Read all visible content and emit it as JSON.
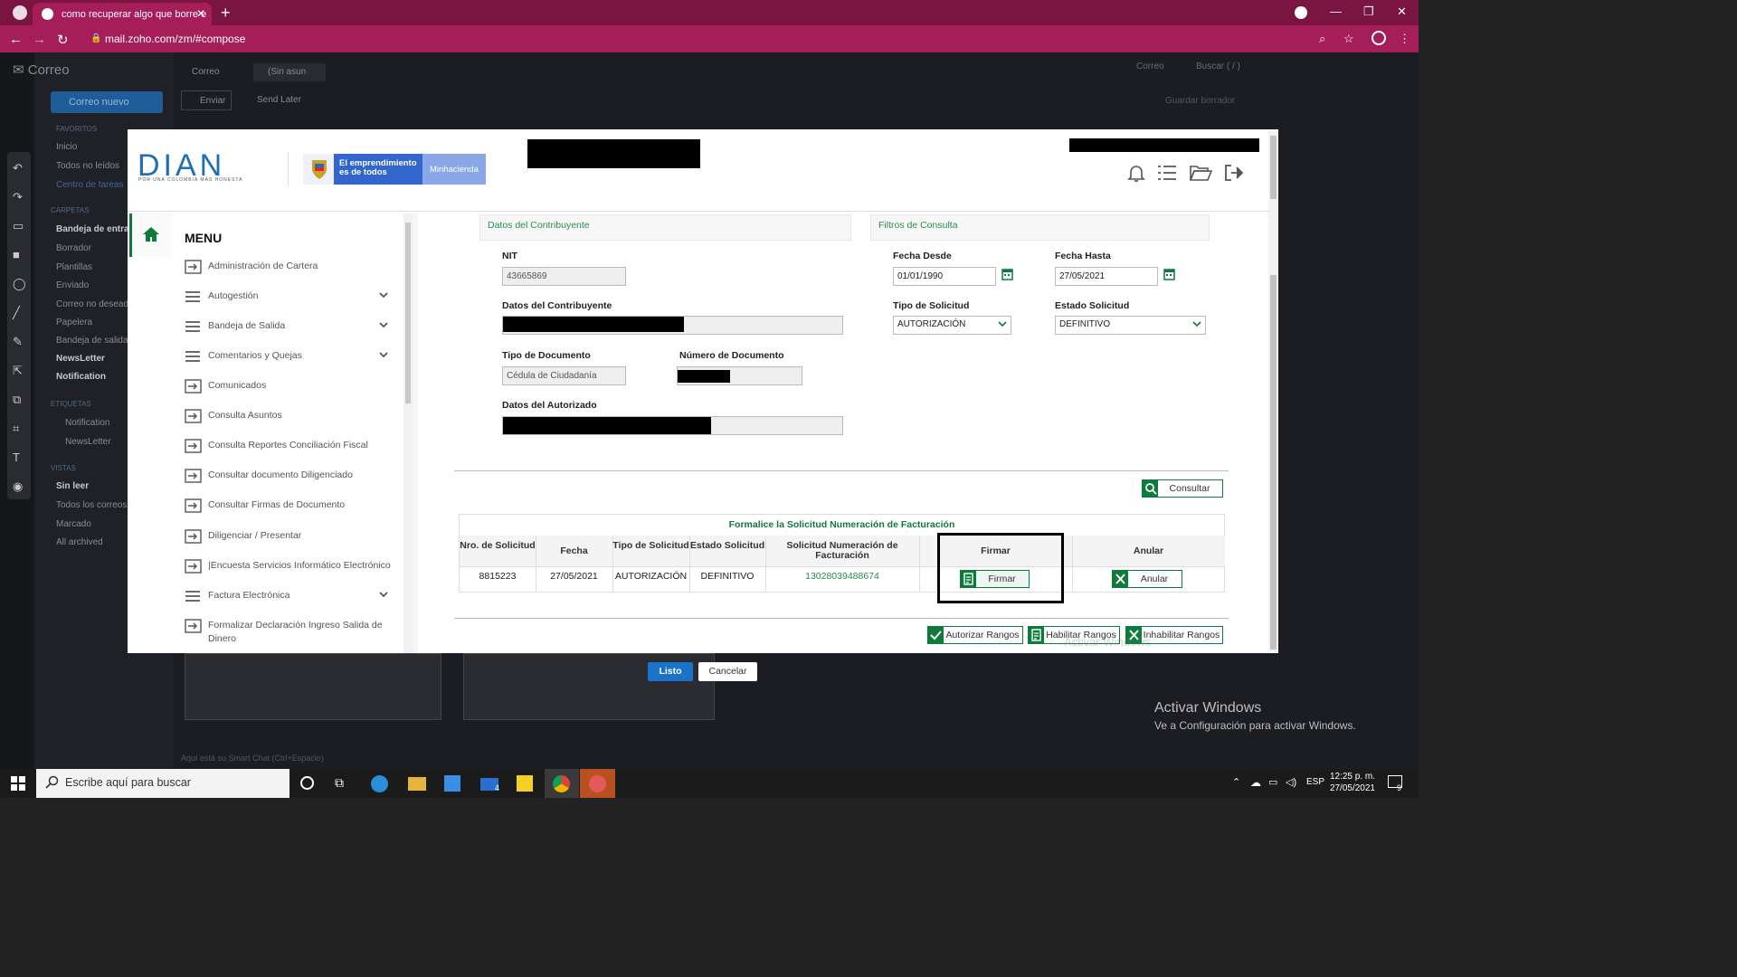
{
  "browser": {
    "tab_title": "como recuperar algo que borre e",
    "url": "mail.zoho.com/zm/#compose"
  },
  "zoho": {
    "app_title": "Correo",
    "tabs": [
      "Correo",
      "(Sin asun"
    ],
    "new_mail": "Correo nuevo",
    "toolbar": {
      "send": "Enviar",
      "send_later": "Send Later"
    },
    "top_right": {
      "scope": "Correo",
      "search": "Buscar ( / )"
    },
    "folders_header": "CARPETAS",
    "favorites_header": "FAVORITOS",
    "favorites": [
      "Inicio",
      "Todos no leídos",
      "Centro de tareas"
    ],
    "folders": [
      "Bandeja de entrada",
      "Borrador",
      "Plantillas",
      "Enviado",
      "Correo no deseado",
      "Papelera",
      "Bandeja de salida",
      "NewsLetter",
      "Notification"
    ],
    "tags_header": "ETIQUETAS",
    "tags": [
      "Notification",
      "NewsLetter"
    ],
    "views_header": "VISTAS",
    "views": [
      "Sin leer",
      "Todos los correos",
      "Marcado",
      "All archived"
    ],
    "compose_hint": "Guardar borrador",
    "chat_hint": "Aquí está su Smart Chat (Ctrl+Espacio)"
  },
  "dian": {
    "logo_text": "DIAN",
    "tagline": "POR UNA COLOMBIA MÁS HONESTA",
    "emblem_main": "El emprendimiento es de todos",
    "emblem_ministry": "Minhacienda"
  },
  "menu": {
    "title": "MENU",
    "items": [
      {
        "label": "Administración de Cartera",
        "icon": "arrow-in-icon",
        "expandable": false
      },
      {
        "label": "Autogestión",
        "icon": "list-icon",
        "expandable": true
      },
      {
        "label": "Bandeja de Salida",
        "icon": "list-icon",
        "expandable": true
      },
      {
        "label": "Comentarios y Quejas",
        "icon": "list-icon",
        "expandable": true
      },
      {
        "label": "Comunicados",
        "icon": "arrow-in-icon",
        "expandable": false
      },
      {
        "label": "Consulta Asuntos",
        "icon": "arrow-in-icon",
        "expandable": false
      },
      {
        "label": "Consulta Reportes Conciliación Fiscal",
        "icon": "arrow-in-icon",
        "expandable": false
      },
      {
        "label": "Consultar documento Diligenciado",
        "icon": "arrow-in-icon",
        "expandable": false
      },
      {
        "label": "Consultar Firmas de Documento",
        "icon": "arrow-in-icon",
        "expandable": false
      },
      {
        "label": "Diligenciar / Presentar",
        "icon": "arrow-in-icon",
        "expandable": false
      },
      {
        "label": "|Encuesta Servicios Informático Electrónico",
        "icon": "arrow-in-icon",
        "expandable": false
      },
      {
        "label": "Factura Electrónica",
        "icon": "list-icon",
        "expandable": true
      },
      {
        "label": "Formalizar Declaración Ingreso Salida de Dinero",
        "icon": "arrow-in-icon",
        "expandable": false
      }
    ]
  },
  "contribuyente": {
    "header": "Datos del Contribuyente",
    "nit_label": "NIT",
    "nit_value": "43665869",
    "datos_label": "Datos del Contribuyente",
    "tipo_doc_label": "Tipo de Documento",
    "tipo_doc_value": "Cédula de Ciudadanía",
    "num_doc_label": "Número de Documento",
    "autorizado_label": "Datos del Autorizado"
  },
  "filtros": {
    "header": "Filtros de Consulta",
    "desde_label": "Fecha Desde",
    "desde_value": "01/01/1990",
    "hasta_label": "Fecha Hasta",
    "hasta_value": "27/05/2021",
    "tipo_label": "Tipo de Solicitud",
    "tipo_value": "AUTORIZACIÓN",
    "estado_label": "Estado Solicitud",
    "estado_value": "DEFINITIVO"
  },
  "consultar_label": "Consultar",
  "table": {
    "title": "Formalice la Solicitud Numeración de Facturación",
    "headers": [
      "Nro. de Solicitud",
      "Fecha",
      "Tipo de Solicitud",
      "Estado Solicitud",
      "Solicitud Numeración de Facturación",
      "Firmar",
      "Anular"
    ],
    "row": {
      "nro": "8815223",
      "fecha": "27/05/2021",
      "tipo": "AUTORIZACIÓN",
      "estado": "DEFINITIVO",
      "solicitud": "13028039488674",
      "firmar": "Firmar",
      "anular": "Anular"
    }
  },
  "actions": {
    "autorizar": "Autorizar Rangos",
    "habilitar": "Habilitar Rangos",
    "inhabilitar": "Inhabilitar Rangos"
  },
  "dialog": {
    "ok": "Listo",
    "cancel": "Cancelar"
  },
  "watermark": {
    "title": "Activar Windows",
    "subtitle": "Ve a Configuración para activar Windows.",
    "overlay": "Activar Windows"
  },
  "taskbar": {
    "search_placeholder": "Escribe aquí para buscar",
    "lang": "ESP",
    "time": "12:25 p. m.",
    "date": "27/05/2021",
    "mail_badge": "4",
    "notif_badge": "9"
  },
  "colors": {
    "accent_green": "#0e7a3c",
    "browser": "#a51e5a",
    "link_green": "#2b8a55"
  }
}
